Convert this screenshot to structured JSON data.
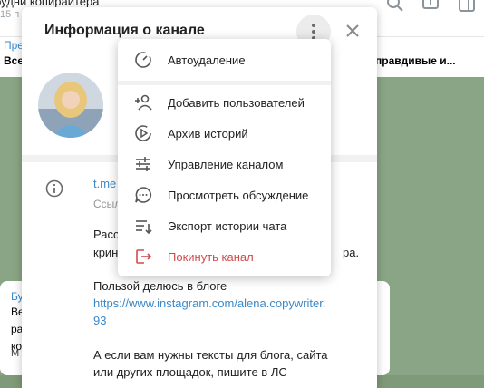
{
  "background": {
    "top_title": "будни копирайтера",
    "top_subtitle": "15 п",
    "pinned_label": "Пре",
    "pinned_text_left": "Все",
    "pinned_text_right": "правдивые и...",
    "msg_label": "Бу",
    "msg_line1": "Ве",
    "msg_line2": "ра",
    "msg_line3": "ко",
    "side_label": "М"
  },
  "dialog": {
    "title": "Информация о канале",
    "link_short": "t.me",
    "link_sub": "Ссыл",
    "desc_line1": "Расс",
    "desc_line2": "крин",
    "desc_line2_tail": "ра.",
    "desc_line3": "Пользой делюсь в блоге",
    "desc_link1": "https://www.instagram.com/alena.copywriter.",
    "desc_link2": "93",
    "desc_line4": "А если вам нужны тексты для блога, сайта",
    "desc_line5": "или других площадок, пишите в ЛС"
  },
  "menu": {
    "items": [
      {
        "label": "Автоудаление",
        "icon": "timer-icon"
      },
      {
        "label": "Добавить пользователей",
        "icon": "add-user-icon"
      },
      {
        "label": "Архив историй",
        "icon": "story-archive-icon"
      },
      {
        "label": "Управление каналом",
        "icon": "sliders-icon"
      },
      {
        "label": "Просмотреть обсуждение",
        "icon": "chat-bubble-icon"
      },
      {
        "label": "Экспорт истории чата",
        "icon": "export-list-icon"
      },
      {
        "label": "Покинуть канал",
        "icon": "leave-icon"
      }
    ]
  },
  "colors": {
    "accent": "#3a88c9",
    "danger": "#d24b4b"
  }
}
